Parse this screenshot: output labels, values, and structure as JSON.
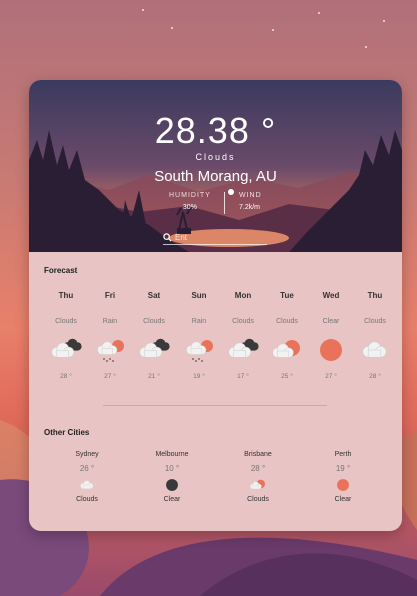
{
  "current": {
    "temperature": "28.38 °",
    "condition": "Clouds",
    "city": "South Morang, AU",
    "humidity_label": "HUMIDITY",
    "humidity_value": "30%",
    "wind_label": "WIND",
    "wind_value": "7.2k/m"
  },
  "search": {
    "placeholder": "Ent"
  },
  "forecast": {
    "title": "Forecast",
    "days": [
      {
        "day": "Thu",
        "condition": "Clouds",
        "temp": "28 °",
        "icon": "cloud-dark-icon"
      },
      {
        "day": "Fri",
        "condition": "Rain",
        "temp": "27 °",
        "icon": "rain-icon"
      },
      {
        "day": "Sat",
        "condition": "Clouds",
        "temp": "21 °",
        "icon": "cloud-dark-icon"
      },
      {
        "day": "Sun",
        "condition": "Rain",
        "temp": "19 °",
        "icon": "rain-icon"
      },
      {
        "day": "Mon",
        "condition": "Clouds",
        "temp": "17 °",
        "icon": "cloud-dark-icon"
      },
      {
        "day": "Tue",
        "condition": "Clouds",
        "temp": "25 °",
        "icon": "cloud-sun-icon"
      },
      {
        "day": "Wed",
        "condition": "Clear",
        "temp": "27 °",
        "icon": "sun-icon"
      },
      {
        "day": "Thu",
        "condition": "Clouds",
        "temp": "28 °",
        "icon": "cloud-icon"
      }
    ]
  },
  "other_cities": {
    "title": "Other Cities",
    "cities": [
      {
        "name": "Sydney",
        "temp": "26 °",
        "condition": "Clouds",
        "icon": "cloud-icon"
      },
      {
        "name": "Melbourne",
        "temp": "10 °",
        "condition": "Clear",
        "icon": "moon-icon"
      },
      {
        "name": "Brisbane",
        "temp": "28 °",
        "condition": "Clouds",
        "icon": "cloud-sun-icon"
      },
      {
        "name": "Perth",
        "temp": "19 °",
        "condition": "Clear",
        "icon": "sun-icon"
      }
    ]
  },
  "colors": {
    "sun": "#e8735a",
    "cloud_light": "#f2f2f2",
    "cloud_dark": "#3a3a3a",
    "card_body": "#e8c4c4"
  }
}
